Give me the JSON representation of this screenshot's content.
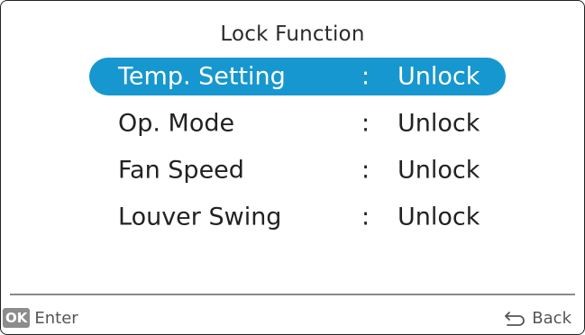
{
  "screen": {
    "title": "Lock Function"
  },
  "menu": {
    "separator": ":",
    "items": [
      {
        "label": "Temp. Setting",
        "value": "Unlock",
        "selected": true
      },
      {
        "label": "Op. Mode",
        "value": "Unlock",
        "selected": false
      },
      {
        "label": "Fan Speed",
        "value": "Unlock",
        "selected": false
      },
      {
        "label": "Louver Swing",
        "value": "Unlock",
        "selected": false
      }
    ]
  },
  "footer": {
    "ok_badge": "OK",
    "enter_label": "Enter",
    "back_label": "Back",
    "icons": {
      "back": "back-arrow-icon"
    }
  },
  "colors": {
    "selection": "#1797cf",
    "border": "#222222",
    "divider": "#8a8a8a",
    "badge": "#8c8c8c"
  }
}
